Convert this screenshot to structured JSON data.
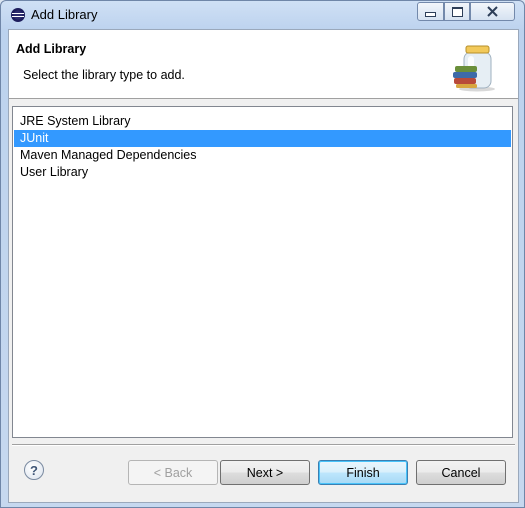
{
  "window": {
    "title": "Add Library",
    "controls": {
      "minimize": "minimize",
      "maximize": "maximize",
      "close": "close"
    }
  },
  "banner": {
    "title": "Add Library",
    "description": "Select the library type to add.",
    "image": "library-jar-icon"
  },
  "library_types": [
    {
      "label": "JRE System Library",
      "selected": false
    },
    {
      "label": "JUnit",
      "selected": true
    },
    {
      "label": "Maven Managed Dependencies",
      "selected": false
    },
    {
      "label": "User Library",
      "selected": false
    }
  ],
  "help": {
    "icon": "help-icon",
    "glyph": "?"
  },
  "buttons": {
    "back": "< Back",
    "next": "Next >",
    "finish": "Finish",
    "cancel": "Cancel"
  },
  "colors": {
    "selection": "#3399ff",
    "default_button_border": "#3c7fb1"
  }
}
